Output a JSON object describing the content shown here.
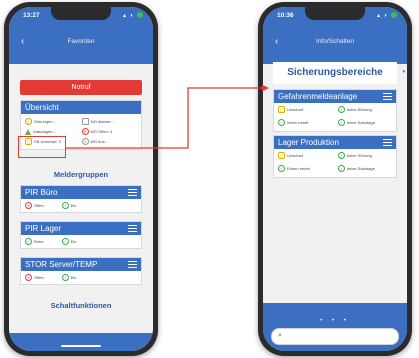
{
  "left_phone": {
    "time": "13:27",
    "title": "Favoriten",
    "notruf_label": "Notruf",
    "overview": {
      "header": "Übersicht",
      "items": [
        {
          "label": "Störungen: -",
          "icon": "warning-triangle-icon"
        },
        {
          "label": "MG Alarme: -",
          "icon": "square-icon"
        },
        {
          "label": "Sabotagen: -",
          "icon": "sabotage-triangle-icon"
        },
        {
          "label": "MG Offen: 4",
          "icon": "x-circle-icon"
        },
        {
          "label": "SB Unscharf: 3",
          "icon": "lock-icon"
        },
        {
          "label": "MG Aus: -",
          "icon": "disabled-icon"
        }
      ]
    },
    "melder_title": "Meldergruppen",
    "groups": [
      {
        "name": "PIR Büro",
        "left": "Offen",
        "left_icon": "x-circle-icon",
        "right": "Ein",
        "right_icon": "info-icon"
      },
      {
        "name": "PIR Lager",
        "left": "Ruhe",
        "left_icon": "check-circle-icon",
        "right": "Ein",
        "right_icon": "info-icon"
      },
      {
        "name": "STOR Server/TEMP",
        "left": "Offen",
        "left_icon": "x-circle-icon",
        "right": "Ein",
        "right_icon": "info-icon"
      }
    ],
    "schalt_title": "Schaltfunktionen"
  },
  "right_phone": {
    "time": "10:36",
    "title": "Info/Schalten",
    "heading": "Sicherungsbereiche",
    "areas": [
      {
        "name": "Gefahrenmeldeanlage",
        "rows": [
          {
            "left": "Unscharf",
            "left_icon": "lock-icon",
            "right": "keine Störung",
            "right_icon": "check-circle-icon"
          },
          {
            "left": "Intern bereit",
            "left_icon": "check-circle-icon",
            "right": "keine Sabotage",
            "right_icon": "check-circle-icon"
          }
        ]
      },
      {
        "name": "Lager Produktion",
        "rows": [
          {
            "left": "Unscharf",
            "left_icon": "lock-icon",
            "right": "keine Störung",
            "right_icon": "check-circle-icon"
          },
          {
            "left": "Extern bereit",
            "left_icon": "check-circle-icon",
            "right": "keine Sabotage",
            "right_icon": "check-circle-icon"
          }
        ]
      }
    ]
  },
  "colors": {
    "brand_blue": "#3b6fc2",
    "alarm_red": "#e53935",
    "ok_green": "#3aa846",
    "unarmed_yellow": "#d4b400"
  }
}
